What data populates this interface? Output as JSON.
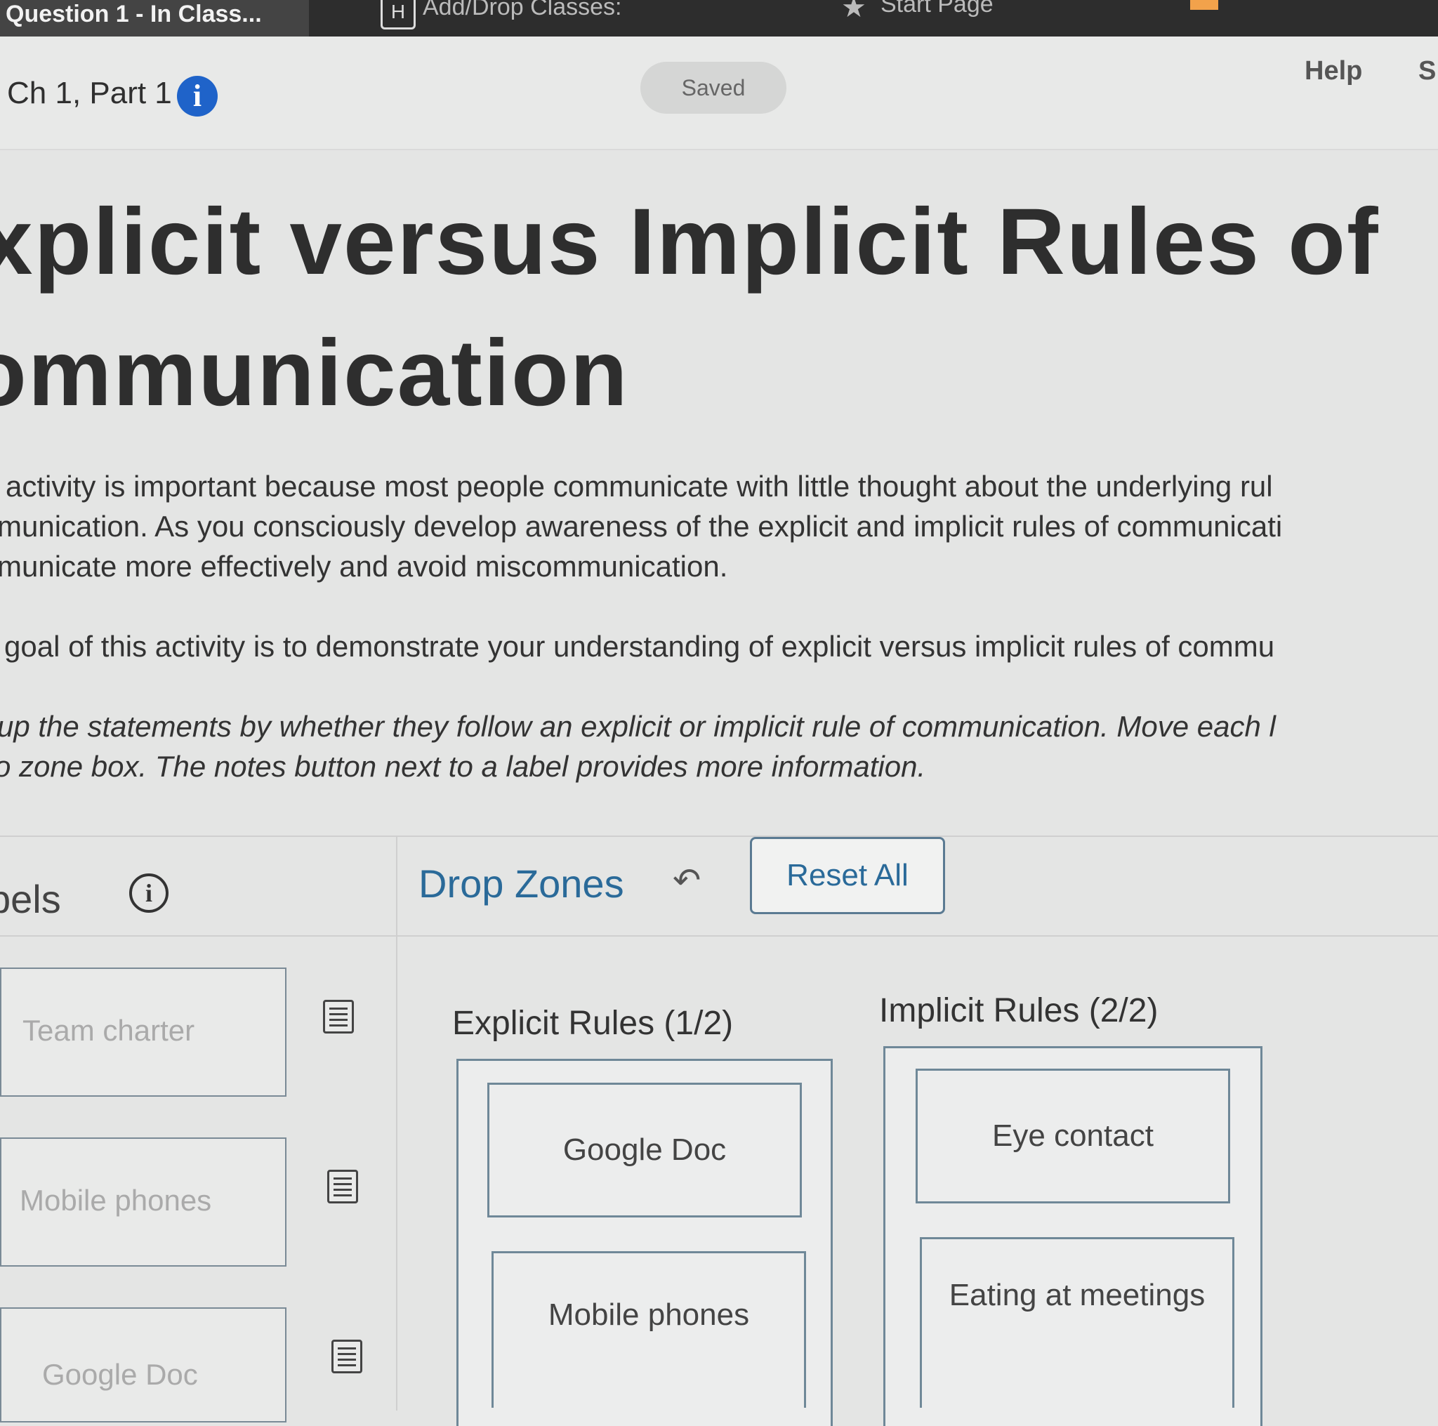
{
  "browser": {
    "tabs": [
      {
        "label": "Question 1 - In Class...",
        "icon": "none"
      },
      {
        "badge": "H",
        "label": "Add/Drop Classes:"
      },
      {
        "label": "Start Page",
        "icon": "star-icon"
      }
    ]
  },
  "header": {
    "assignment_title": "Ch 1, Part 1",
    "info_glyph": "i",
    "status": "Saved",
    "help": "Help",
    "s_link": "S"
  },
  "content": {
    "title_line1": "xplicit versus Implicit Rules of",
    "title_line2": "ommunication",
    "para1_lines": [
      "activity is important because most people communicate with little thought about the underlying rul",
      "munication. As you consciously develop awareness of the explicit and implicit rules of communicati",
      "municate more effectively and avoid miscommunication."
    ],
    "para2": "goal of this activity is to demonstrate your understanding of explicit versus implicit rules of commu",
    "instructions_lines": [
      "up the statements by whether they follow an explicit or implicit rule of communication. Move each l",
      "o zone box. The notes button next to a label provides more information."
    ]
  },
  "activity": {
    "labels_heading": "bels",
    "labels_info_glyph": "i",
    "drop_zones_heading": "Drop Zones",
    "undo_glyph": "↶",
    "reset_all": "Reset All",
    "labels": [
      "Team charter",
      "Mobile phones",
      "Google Doc"
    ],
    "zones": [
      {
        "title": "Explicit Rules (1/2)",
        "items": [
          "Google Doc",
          "Mobile phones"
        ]
      },
      {
        "title": "Implicit Rules (2/2)",
        "items": [
          "Eye contact",
          "Eating at meetings"
        ]
      }
    ]
  },
  "colors": {
    "accent_blue": "#1f63c9",
    "heading_blue": "#2a6a99",
    "tabbar": "#2d2d2d"
  }
}
